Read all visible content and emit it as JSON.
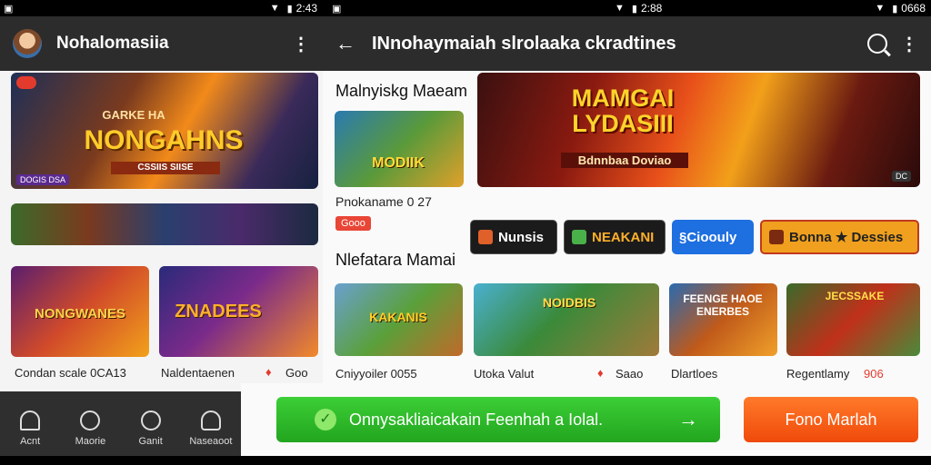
{
  "left": {
    "status_time": "2:43",
    "app_title": "Nohalomasiia",
    "hero": {
      "title": "NONGAHNS",
      "subtitle": "GARKE HA",
      "strap": "CSSIIS SIISE",
      "badge": "DOGIS DSA"
    },
    "banner2_label": "",
    "cards": [
      {
        "art_title": "NONGWANES",
        "caption": "Condan scale 0CA13"
      },
      {
        "art_title": "ZNADEES",
        "caption": "Naldentaenen",
        "pin_text": "Goo"
      }
    ],
    "bottom_nav": [
      {
        "icon": "home-icon",
        "label": "Acnt"
      },
      {
        "icon": "compass-icon",
        "label": "Maorie"
      },
      {
        "icon": "clock-icon",
        "label": "Ganit"
      },
      {
        "icon": "profile-icon",
        "label": "Naseaoot"
      }
    ]
  },
  "right": {
    "status_time": "2:88",
    "status_right": "0668",
    "app_title": "INnohaymaiah slrolaaka ckradtines",
    "section1": "Malnyiskg Maeam",
    "featured_card": {
      "art_title": "MODIIK",
      "caption": "Pnokaname 0 27",
      "tag": "Gooo"
    },
    "hero": {
      "title": "MAMGAI LYDASIII",
      "strap": "Bdnnbaa Doviao",
      "badge": "DC"
    },
    "chips": [
      {
        "label": "Nunsis",
        "icon": "guitar-icon",
        "color": "#1b1b1b"
      },
      {
        "label": "NEAKANI",
        "icon": "gamepad-icon",
        "color": "#1b1b1b"
      },
      {
        "label": "§Cioouly",
        "icon": "",
        "color": "#1e6fe0"
      },
      {
        "label": "Bonna ★ Dessies",
        "icon": "grid-icon",
        "color": "#f0a01e"
      }
    ],
    "section2": "Nlefatara Mamai",
    "row_cards": [
      {
        "art_title": "KAKANIS",
        "caption": "Cniyyoiler 0055"
      },
      {
        "art_title": "NOIDBIS",
        "caption": "Utoka Valut",
        "pin_text": "Saao"
      },
      {
        "art_title": "FEENGE HAOE ENERBES",
        "caption": "Dlartloes"
      },
      {
        "art_title": "JECSSAKE",
        "caption": "Regentlamy",
        "tag_text": "906"
      }
    ],
    "cta_primary": "Onnysakliaicakain Feenhah a Iolal.",
    "cta_secondary": "Fono Marlah"
  },
  "colors": {
    "green": "#2db32b",
    "orange": "#ff5a14",
    "dark": "#2c2c2c",
    "accent_red": "#e23b2e"
  }
}
